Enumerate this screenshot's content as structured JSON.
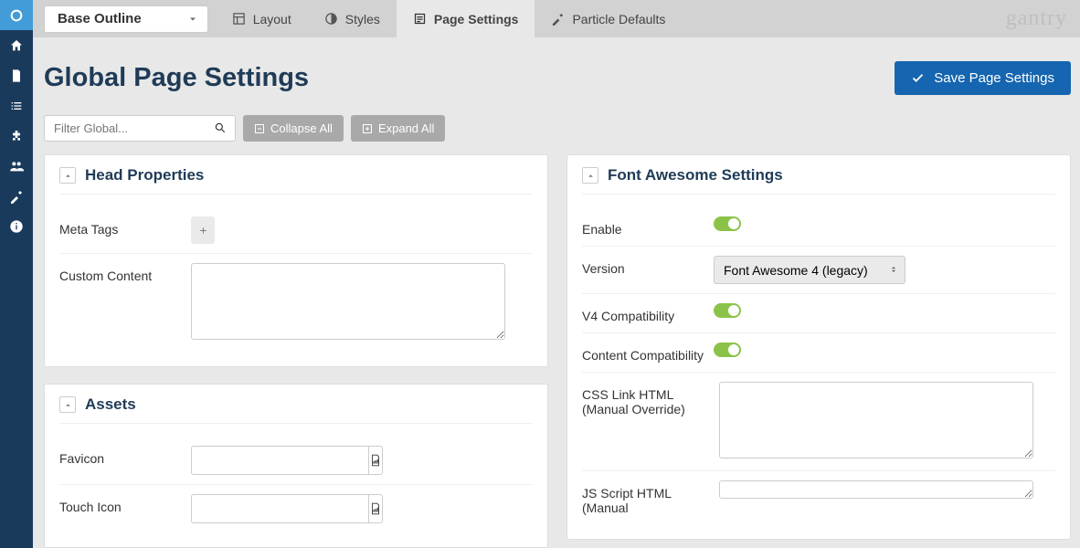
{
  "outline": {
    "selected": "Base Outline"
  },
  "tabs": {
    "layout": "Layout",
    "styles": "Styles",
    "page_settings": "Page Settings",
    "particle_defaults": "Particle Defaults"
  },
  "brand": "gantry",
  "page_title": "Global Page Settings",
  "save_button": "Save Page Settings",
  "filter_placeholder": "Filter Global...",
  "collapse_all": "Collapse All",
  "expand_all": "Expand All",
  "panels": {
    "head_properties": {
      "title": "Head Properties",
      "meta_tags_label": "Meta Tags",
      "custom_content_label": "Custom Content",
      "custom_content_value": ""
    },
    "assets": {
      "title": "Assets",
      "favicon_label": "Favicon",
      "favicon_value": "",
      "touch_icon_label": "Touch Icon",
      "touch_icon_value": ""
    },
    "font_awesome": {
      "title": "Font Awesome Settings",
      "enable_label": "Enable",
      "version_label": "Version",
      "version_value": "Font Awesome 4 (legacy)",
      "v4_compat_label": "V4 Compatibility",
      "content_compat_label": "Content Compatibility",
      "css_link_label": "CSS Link HTML (Manual Override)",
      "css_link_value": "",
      "js_script_label": "JS Script HTML (Manual"
    }
  }
}
